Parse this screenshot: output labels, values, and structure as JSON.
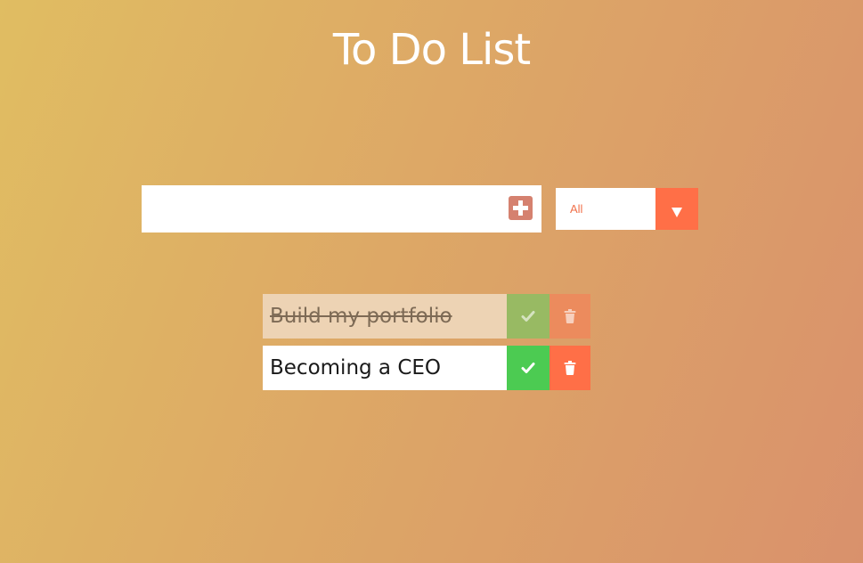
{
  "header": {
    "title": "To Do List"
  },
  "form": {
    "input_value": "",
    "input_placeholder": "",
    "add_icon": "plus-square-icon"
  },
  "filter": {
    "selected": "All",
    "arrow_icon": "triangle-down-icon"
  },
  "todos": [
    {
      "text": "Build my portfolio",
      "completed": true
    },
    {
      "text": "Becoming a CEO",
      "completed": false
    }
  ],
  "icons": {
    "complete": "check-icon",
    "delete": "trash-icon"
  },
  "colors": {
    "gradient_start": "#e0bd62",
    "gradient_end": "#d9916c",
    "accent": "#ff6f47",
    "complete": "#4ccb52",
    "add_button": "#d5816f"
  }
}
